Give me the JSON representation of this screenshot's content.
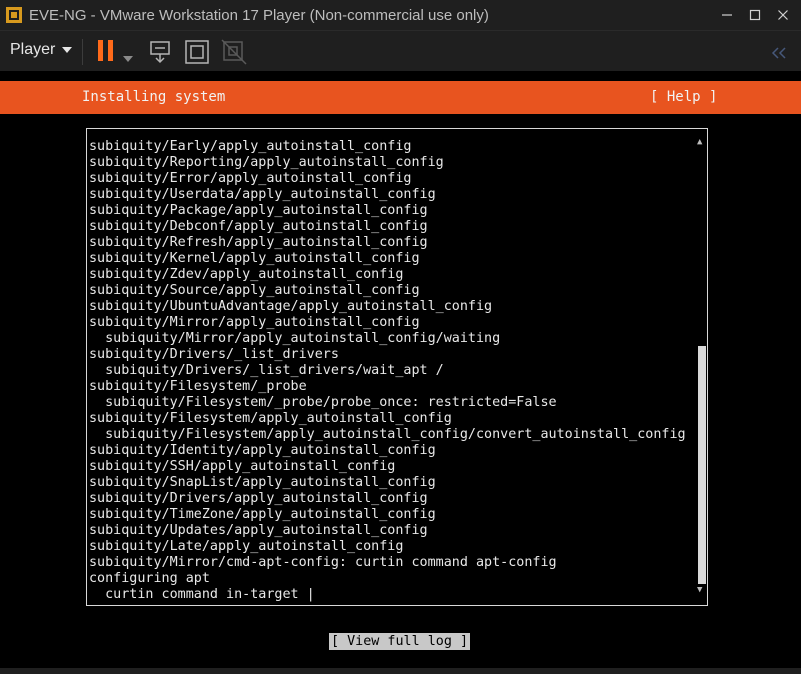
{
  "window": {
    "title": "EVE-NG - VMware Workstation 17 Player (Non-commercial use only)"
  },
  "toolbar": {
    "player_label": "Player"
  },
  "installer": {
    "header_title": "Installing system",
    "help_label": "[ Help ]",
    "log_lines": [
      "subiquity/Early/apply_autoinstall_config",
      "subiquity/Reporting/apply_autoinstall_config",
      "subiquity/Error/apply_autoinstall_config",
      "subiquity/Userdata/apply_autoinstall_config",
      "subiquity/Package/apply_autoinstall_config",
      "subiquity/Debconf/apply_autoinstall_config",
      "subiquity/Refresh/apply_autoinstall_config",
      "subiquity/Kernel/apply_autoinstall_config",
      "subiquity/Zdev/apply_autoinstall_config",
      "subiquity/Source/apply_autoinstall_config",
      "subiquity/UbuntuAdvantage/apply_autoinstall_config",
      "subiquity/Mirror/apply_autoinstall_config",
      "  subiquity/Mirror/apply_autoinstall_config/waiting",
      "subiquity/Drivers/_list_drivers",
      "  subiquity/Drivers/_list_drivers/wait_apt /",
      "subiquity/Filesystem/_probe",
      "  subiquity/Filesystem/_probe/probe_once: restricted=False",
      "subiquity/Filesystem/apply_autoinstall_config",
      "  subiquity/Filesystem/apply_autoinstall_config/convert_autoinstall_config",
      "subiquity/Identity/apply_autoinstall_config",
      "subiquity/SSH/apply_autoinstall_config",
      "subiquity/SnapList/apply_autoinstall_config",
      "subiquity/Drivers/apply_autoinstall_config",
      "subiquity/TimeZone/apply_autoinstall_config",
      "subiquity/Updates/apply_autoinstall_config",
      "subiquity/Late/apply_autoinstall_config",
      "subiquity/Mirror/cmd-apt-config: curtin command apt-config",
      "configuring apt",
      "  curtin command in-target |"
    ],
    "view_log_label": "[ View full log ]"
  },
  "colors": {
    "header": "#e8541f",
    "pause_icon": "#ff6a1a",
    "chrome": "#1f1f1f"
  }
}
